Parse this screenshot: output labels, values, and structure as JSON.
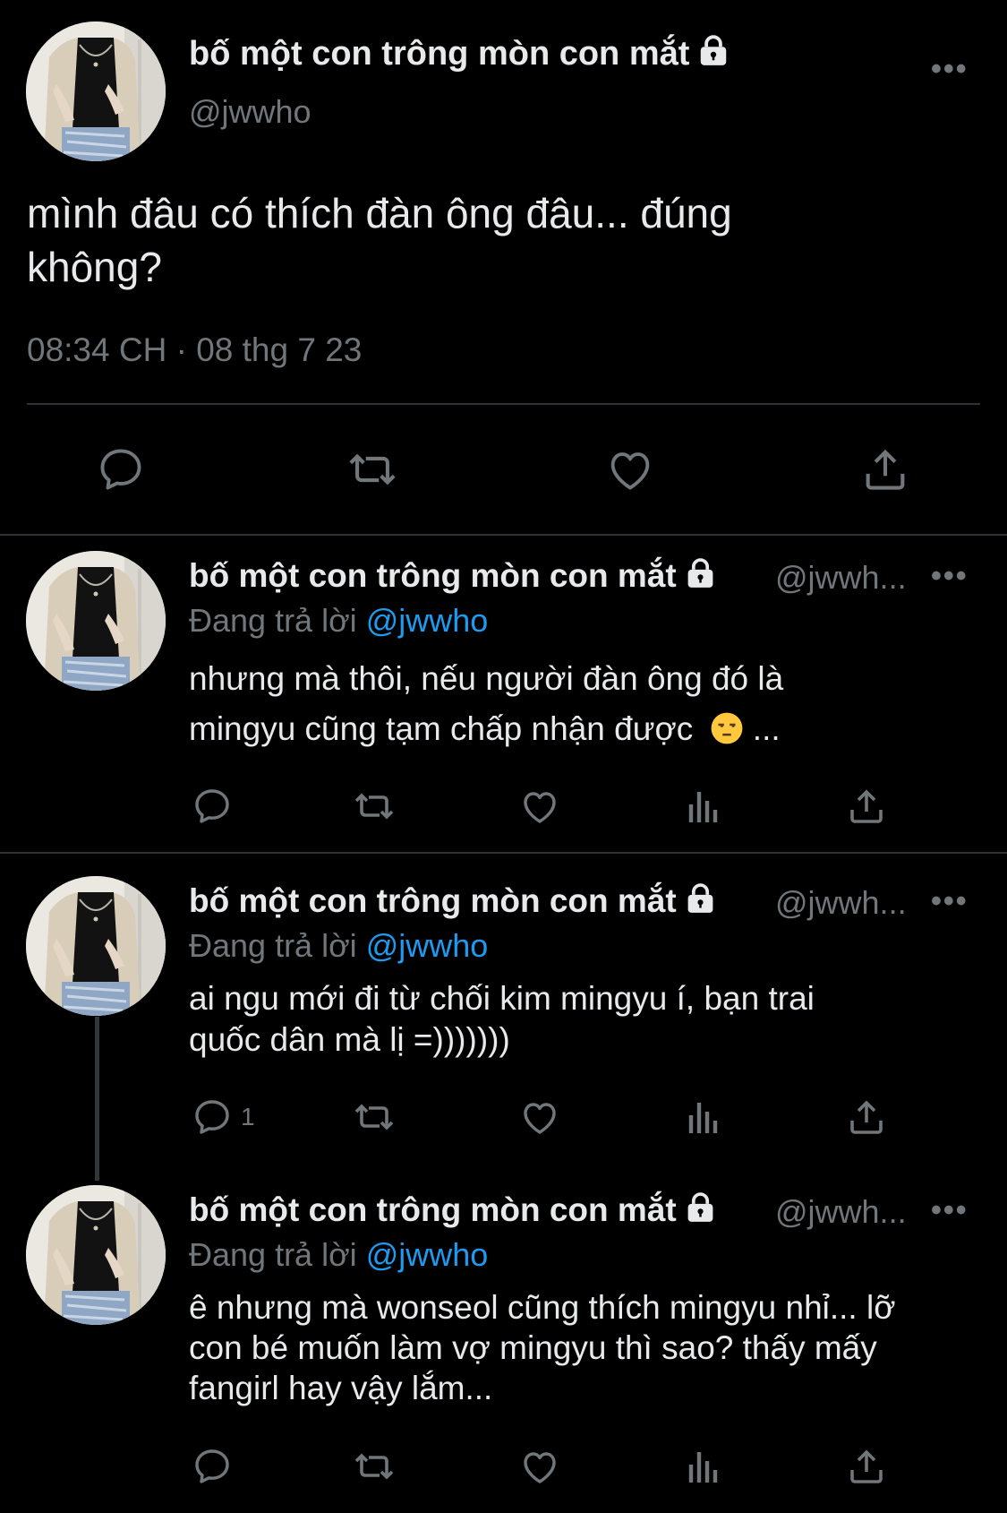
{
  "main_tweet": {
    "display_name": "bố một con trông mòn con mắt",
    "handle": "@jwwho",
    "text_line1": "mình đâu có thích đàn ông đâu... đúng",
    "text_line2": "không?",
    "timestamp": "08:34 CH · 08 thg 7 23",
    "more": "•••"
  },
  "replies": [
    {
      "display_name": "bố một con trông mòn con mắt",
      "handle": "@jwwh...",
      "replying_prefix": "Đang trả lời",
      "replying_to": "@jwwho",
      "line1": "nhưng mà thôi, nếu người đàn ông đó là",
      "line2": "mingyu cũng tạm chấp nhận được",
      "line2_tail": " ...",
      "emoji": "unamused-face-icon",
      "reply_count": "",
      "more": "•••"
    },
    {
      "display_name": "bố một con trông mòn con mắt",
      "handle": "@jwwh...",
      "replying_prefix": "Đang trả lời",
      "replying_to": "@jwwho",
      "line1": "ai ngu mới đi từ chối kim mingyu í, bạn trai",
      "line2": "quốc dân mà lị =)))))))",
      "reply_count": "1",
      "more": "•••"
    },
    {
      "display_name": "bố một con trông mòn con mắt",
      "handle": "@jwwh...",
      "replying_prefix": "Đang trả lời",
      "replying_to": "@jwwho",
      "line1": "ê nhưng mà wonseol cũng thích mingyu nhỉ... lỡ",
      "line2": "con bé muốn làm vợ mingyu thì sao? thấy mấy",
      "line3": "fangirl hay vậy lắm...",
      "reply_count": "",
      "more": "•••"
    }
  ],
  "colors": {
    "background": "#000000",
    "text": "#e7e9ea",
    "secondary": "#71767b",
    "mention": "#1d9bf0",
    "divider": "#2f3336"
  }
}
